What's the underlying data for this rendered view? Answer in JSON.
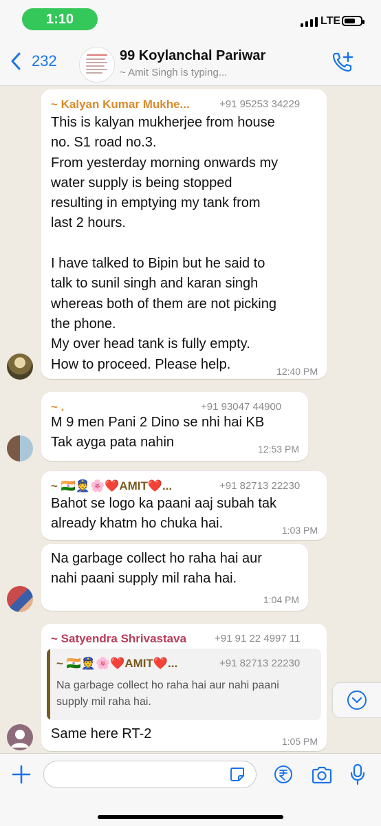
{
  "status_bar": {
    "time": "1:10",
    "network": "LTE"
  },
  "header": {
    "back_count": "232",
    "title": "99 Koylanchal Pariwar",
    "subtitle": "~ Amit Singh is typing..."
  },
  "messages": [
    {
      "sender": "~ Kalyan Kumar Mukhe...",
      "sender_color": "#d98a2b",
      "phone": "+91 95253 34229",
      "text": "This is kalyan mukherjee from house\nno. S1 road no.3.\nFrom yesterday morning onwards my\nwater supply is being stopped\nresulting in emptying my tank from\nlast 2 hours.\n\nI have talked to Bipin but he said to\ntalk to sunil singh and karan singh\nwhereas both of them are not picking\nthe phone.\nMy over head tank is fully empty.\nHow to proceed. Please help.",
      "time": "12:40 PM"
    },
    {
      "sender": "~ .",
      "sender_color": "#d98a2b",
      "phone": "+91 93047 44900",
      "text": "M 9 men Pani 2 Dino se nhi hai  KB\nTak ayga pata nahin",
      "time": "12:53 PM"
    },
    {
      "sender": "~ 🇮🇳👮🌸❤️AMIT❤️...",
      "sender_color": "#7a5a1f",
      "phone": "+91 82713 22230",
      "text": "Bahot se logo ka paani aaj subah tak\nalready khatm ho chuka hai.",
      "time": "1:03 PM"
    },
    {
      "text": "Na garbage collect ho raha hai aur\nnahi paani supply mil raha hai.",
      "time": "1:04 PM"
    },
    {
      "sender": "~ Satyendra Shrivastava",
      "sender_color": "#b83d5a",
      "phone": "+91 91 22 4997 11",
      "quote": {
        "sender": "~ 🇮🇳👮🌸❤️AMIT❤️...",
        "phone": "+91 82713 22230",
        "text": "Na garbage collect ho raha hai aur nahi paani\nsupply mil raha hai."
      },
      "text": "Same here RT-2",
      "time": "1:05 PM"
    }
  ],
  "composer": {
    "placeholder": ""
  },
  "icons": [
    "back-chevron-icon",
    "add-call-icon",
    "scroll-down-icon",
    "plus-icon",
    "sticker-icon",
    "rupee-icon",
    "camera-icon",
    "microphone-icon"
  ]
}
